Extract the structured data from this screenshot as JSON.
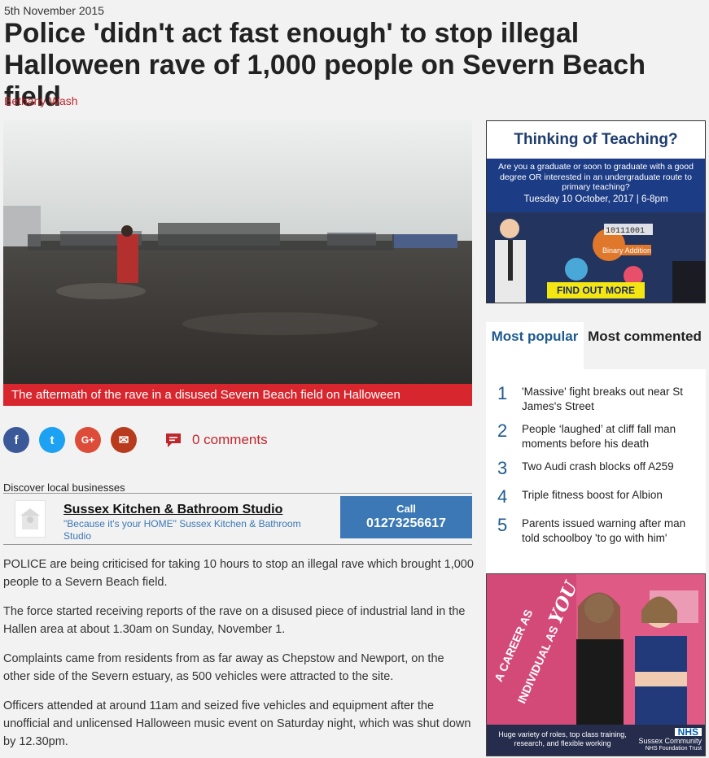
{
  "article": {
    "date": "5th November 2015",
    "headline": "Police 'didn't act fast enough' to stop illegal Halloween rave of 1,000 people on Severn Beach field",
    "author": "Bethany Wash",
    "caption": "The aftermath of the rave in a disused Severn Beach field on Halloween",
    "paragraphs": [
      "POLICE are being criticised for taking 10 hours to stop an illegal rave which brought 1,000 people to a Severn Beach field.",
      "The force started receiving reports of the rave on a disused piece of industrial land in the Hallen area at about 1.30am on Sunday, November 1.",
      "Complaints came from residents from as far away as Chepstow and Newport, on the other side of the Severn estuary, as 500 vehicles were attracted to the site.",
      "Officers attended at around 11am and seized five vehicles and equipment after the unofficial and unlicensed Halloween music event on Saturday night, which was shut down by 12.30pm."
    ]
  },
  "share": {
    "facebook": "f",
    "twitter": "t",
    "googleplus": "G+",
    "email": "✉",
    "comments_label": "0 comments"
  },
  "local": {
    "title": "Discover local businesses",
    "name": "Sussex Kitchen & Bathroom Studio",
    "tagline": "\"Because it's your HOME\" Sussex Kitchen & Bathroom Studio",
    "call_label": "Call",
    "phone": "01273256617"
  },
  "ad_teaching": {
    "title": "Thinking of Teaching?",
    "text": "Are you a graduate or soon to graduate with a good degree OR interested in an undergraduate route to primary teaching?",
    "date": "Tuesday 10 October, 2017 | 6-8pm",
    "button": "FIND OUT MORE",
    "img_binary": "10111001",
    "img_label": "Binary Addition"
  },
  "popular": {
    "tab_popular": "Most popular",
    "tab_commented": "Most commented",
    "items": [
      {
        "num": "1",
        "text": "'Massive' fight breaks out near St James's Street"
      },
      {
        "num": "2",
        "text": "People ‘laughed’ at cliff fall man moments before his death"
      },
      {
        "num": "3",
        "text": "Two Audi crash blocks off A259"
      },
      {
        "num": "4",
        "text": "Triple fitness boost for Albion"
      },
      {
        "num": "5",
        "text": "Parents issued warning after man told schoolboy 'to go with him'"
      }
    ]
  },
  "ad_nhs": {
    "slogan_1": "A CAREER AS",
    "slogan_2": "INDIVIDUAL AS",
    "slogan_3": "YOU",
    "footer": "Huge variety of roles, top class training, research, and flexible working",
    "logo": "NHS",
    "org": "Sussex Community",
    "trust": "NHS Foundation Trust"
  },
  "colors": {
    "accent_red": "#d8262e",
    "link_blue": "#3b78b5",
    "popular_blue": "#1d5a8e"
  }
}
